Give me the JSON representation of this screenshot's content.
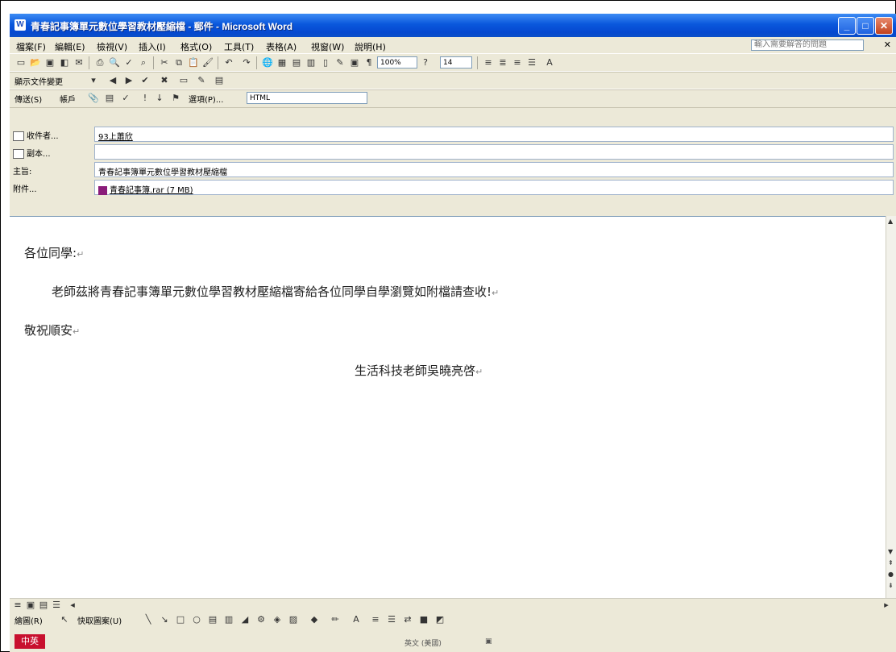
{
  "window": {
    "title": "青春記事簿單元數位學習教材壓縮檔 - 郵件 - Microsoft Word"
  },
  "menubar": {
    "items": [
      "檔案(F)",
      "編輯(E)",
      "檢視(V)",
      "插入(I)",
      "格式(O)",
      "工具(T)",
      "表格(A)",
      "視窗(W)",
      "說明(H)"
    ],
    "help_placeholder": "輸入需要解答的問題"
  },
  "toolbar_standard": {
    "zoom": "100%",
    "font_size": "14"
  },
  "toolbar_reading": {
    "label": "顯示文件變更"
  },
  "toolbar_email": {
    "send_label": "傳送(S)",
    "accounts_label": "帳戶",
    "options_label": "選項(P)...",
    "format": "HTML"
  },
  "fields": {
    "to_label": "收件者...",
    "to_value": "93上蕭欣",
    "cc_label": "副本...",
    "cc_value": "",
    "subject_label": "主旨:",
    "subject_value": "青春記事簿單元數位學習教材壓縮檔",
    "attach_label": "附件...",
    "attach_value": "青春記事簿.rar (7 MB)"
  },
  "document": {
    "line1": "各位同學:",
    "line2": "老師茲將青春記事簿單元數位學習教材壓縮檔寄給各位同學自學瀏覽如附檔請查收!",
    "line3": "敬祝順安",
    "line4": "生活科技老師吳曉亮啓"
  },
  "drawbar": {
    "draw_label": "繪圖(R)",
    "autoshapes_label": "快取圖案(U)"
  },
  "statusbar": {
    "ime": "中英",
    "lang": "英文 (美國)"
  },
  "colors": {
    "titlebar": "#0a58dc",
    "chrome": "#ece9d8",
    "ime_badge": "#c8102e"
  }
}
